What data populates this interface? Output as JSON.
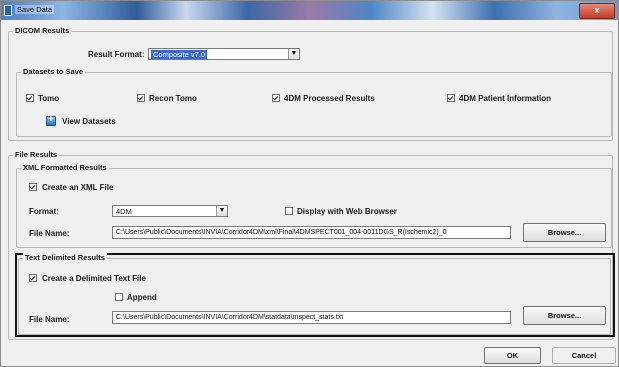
{
  "window": {
    "title": "Save Data",
    "close_label": "x"
  },
  "dicom": {
    "legend": "DICOM Results",
    "result_format_label": "Result Format:",
    "result_format_value": "Composite v7.0",
    "datasets": {
      "legend": "Datasets to Save",
      "items": [
        {
          "label": "Tomo",
          "checked": true
        },
        {
          "label": "Recon Tomo",
          "checked": true
        },
        {
          "label": "4DM Processed Results",
          "checked": true
        },
        {
          "label": "4DM Patient Information",
          "checked": true
        }
      ],
      "view_label": "View Datasets"
    }
  },
  "file_results": {
    "legend": "File Results",
    "xml": {
      "legend": "XML Formatted Results",
      "create_label": "Create an XML File",
      "create_checked": true,
      "format_label": "Format:",
      "format_value": "4DM",
      "display_web_label": "Display with Web Browser",
      "display_web_checked": false,
      "file_name_label": "File Name:",
      "file_name_value": "C:\\Users\\Public\\Documents\\INVIA\\Corridor4DM\\xml\\Final\\4DMSPECT001_004-0011DGS_R(Ischemic2)_0",
      "browse_label": "Browse..."
    },
    "text": {
      "legend": "Text Delimited Results",
      "create_label": "Create a Delimited Text File",
      "create_checked": true,
      "append_label": "Append",
      "append_checked": false,
      "file_name_label": "File Name:",
      "file_name_value": "C:\\Users\\Public\\Documents\\INVIA\\Corridor4DM\\statdata\\mspect_stats.txt",
      "browse_label": "Browse..."
    }
  },
  "footer": {
    "ok_label": "OK",
    "cancel_label": "Cancel"
  },
  "colors": {
    "selection": "#3a67c8",
    "frame": "#111111",
    "window_bg": "#f0f0f0"
  }
}
